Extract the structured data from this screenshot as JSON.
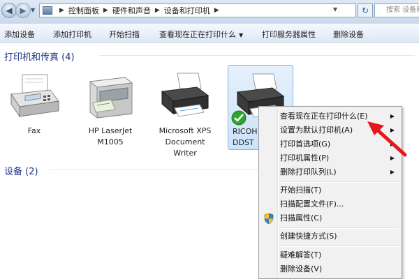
{
  "address": {
    "crumbs": [
      "控制面板",
      "硬件和声音",
      "设备和打印机"
    ],
    "search_placeholder": "搜索 设备和打印机"
  },
  "toolbar": {
    "add_device": "添加设备",
    "add_printer": "添加打印机",
    "start_scan": "开始扫描",
    "see_printing": "查看现在正在打印什么",
    "print_server_props": "打印服务器属性",
    "remove_device": "删除设备"
  },
  "groups": {
    "printers_header": "打印机和传真 (4)",
    "devices_header": "设备 (2)"
  },
  "printers": [
    {
      "label": "Fax"
    },
    {
      "label": "HP LaserJet\nM1005"
    },
    {
      "label": "Microsoft XPS\nDocument\nWriter"
    },
    {
      "label": "RICOH\nDDST"
    }
  ],
  "context_menu": {
    "items": [
      {
        "label": "查看现在正在打印什么(E)",
        "submenu": true
      },
      {
        "label": "设置为默认打印机(A)",
        "submenu": true
      },
      {
        "label": "打印首选项(G)",
        "submenu": true
      },
      {
        "label": "打印机属性(P)",
        "submenu": true
      },
      {
        "label": "删除打印队列(L)",
        "submenu": true
      },
      {
        "label": "开始扫描(T)",
        "submenu": false
      },
      {
        "label": "扫描配置文件(F)...",
        "submenu": false
      },
      {
        "label": "扫描属性(C)",
        "submenu": false,
        "icon": "uac-shield-icon"
      },
      {
        "label": "创建快捷方式(S)",
        "submenu": false
      },
      {
        "label": "疑难解答(T)",
        "submenu": false
      },
      {
        "label": "删除设备(V)",
        "submenu": false
      }
    ]
  },
  "colors": {
    "group_header": "#1e3287",
    "selection": "#cde3f9",
    "arrow": "#e8161b",
    "default_check": "#2da52d"
  }
}
